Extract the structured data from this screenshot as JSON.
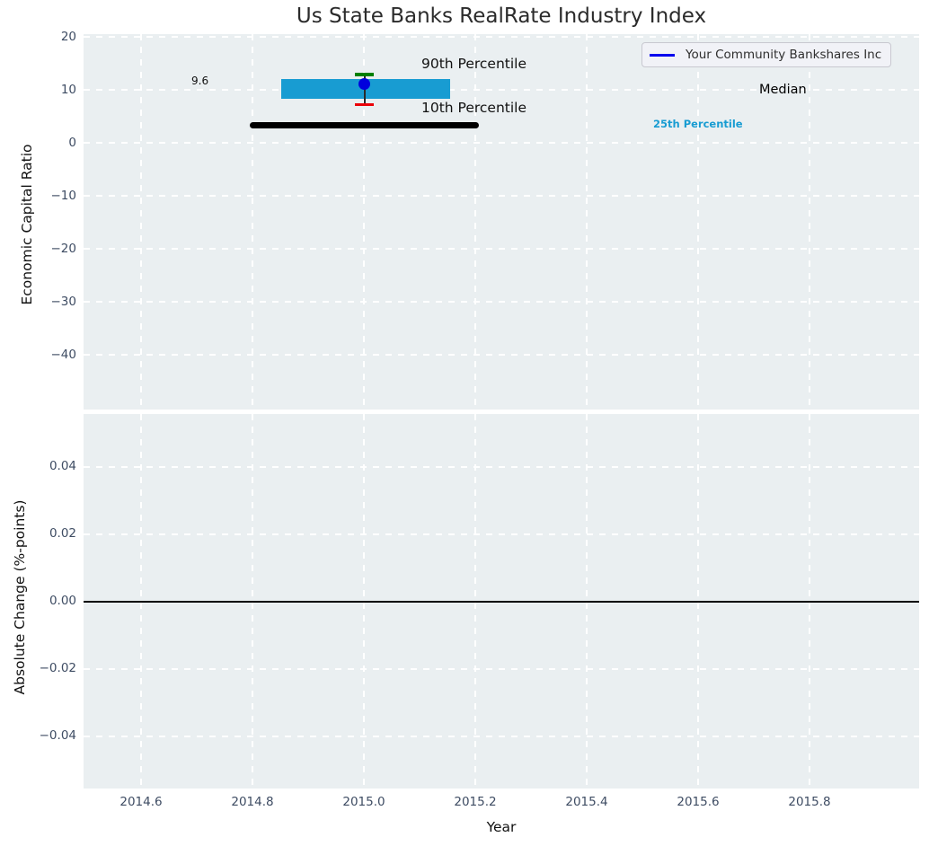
{
  "figure": {
    "title": "Us State Banks RealRate Industry Index"
  },
  "legend": {
    "label": "Your Community Bankshares Inc"
  },
  "top_plot": {
    "ylabel": "Economic Capital Ratio",
    "yticks": [
      "20",
      "10",
      "0",
      "−10",
      "−20",
      "−30",
      "−40"
    ],
    "annotations": {
      "median_value": "9.6",
      "p90_label": "90th Percentile",
      "p10_label": "10th Percentile",
      "p25_label": "25th Percentile",
      "median_label": "Median"
    }
  },
  "bottom_plot": {
    "ylabel": "Absolute Change (%-points)",
    "yticks": [
      "0.04",
      "0.02",
      "0.00",
      "−0.02",
      "−0.04"
    ]
  },
  "xaxis": {
    "label": "Year",
    "ticks": [
      "2014.6",
      "2014.8",
      "2015.0",
      "2015.2",
      "2015.4",
      "2015.6",
      "2015.8"
    ]
  },
  "colors": {
    "company_blue": "#0000ee",
    "percentile_band_cyan": "#189cd2",
    "p90_green": "#008000",
    "p10_red": "#eb0008",
    "median_black": "#000000",
    "plot_background": "#eaeff1",
    "tick_label": "#3e4c63"
  },
  "chart_data": [
    {
      "type": "scatter",
      "title": "Us State Banks RealRate Industry Index",
      "xlabel": "Year",
      "ylabel": "Economic Capital Ratio",
      "xlim": [
        2014.5,
        2016.0
      ],
      "ylim": [
        -50.5,
        20.5
      ],
      "grid": true,
      "legend_position": "upper right",
      "legend_entries": [
        "Your Community Bankshares Inc"
      ],
      "series": [
        {
          "name": "Your Community Bankshares Inc",
          "type": "scatter",
          "marker": "circle",
          "color": "#0000dd",
          "x": [
            2015.0
          ],
          "y": [
            11.0
          ]
        },
        {
          "name": "Median",
          "type": "line",
          "color": "#000000",
          "linewidth": 7,
          "x": [
            2014.8,
            2015.2
          ],
          "y": [
            9.6,
            9.6
          ],
          "data_label": "9.6"
        },
        {
          "name": "25th-75th Percentile band",
          "type": "area",
          "color": "#189cd2",
          "x": [
            2014.85,
            2015.15
          ],
          "y_low": 8.2,
          "y_high": 11.9
        },
        {
          "name": "90th Percentile",
          "type": "errorbar_cap",
          "color": "#008000",
          "x": [
            2015.0
          ],
          "y": [
            13.0
          ]
        },
        {
          "name": "10th Percentile",
          "type": "errorbar_cap",
          "color": "#eb0008",
          "x": [
            2015.0
          ],
          "y": [
            7.2
          ]
        }
      ],
      "annotations": [
        "9.6",
        "90th Percentile",
        "10th Percentile",
        "25th Percentile",
        "Median"
      ]
    },
    {
      "type": "line",
      "title": "",
      "xlabel": "Year",
      "ylabel": "Absolute Change (%-points)",
      "xlim": [
        2014.5,
        2016.0
      ],
      "ylim": [
        -0.055,
        0.055
      ],
      "grid": true,
      "series": [
        {
          "name": "zero-baseline",
          "type": "line",
          "color": "#000000",
          "x": [
            2014.5,
            2016.0
          ],
          "y": [
            0.0,
            0.0
          ]
        }
      ]
    }
  ]
}
